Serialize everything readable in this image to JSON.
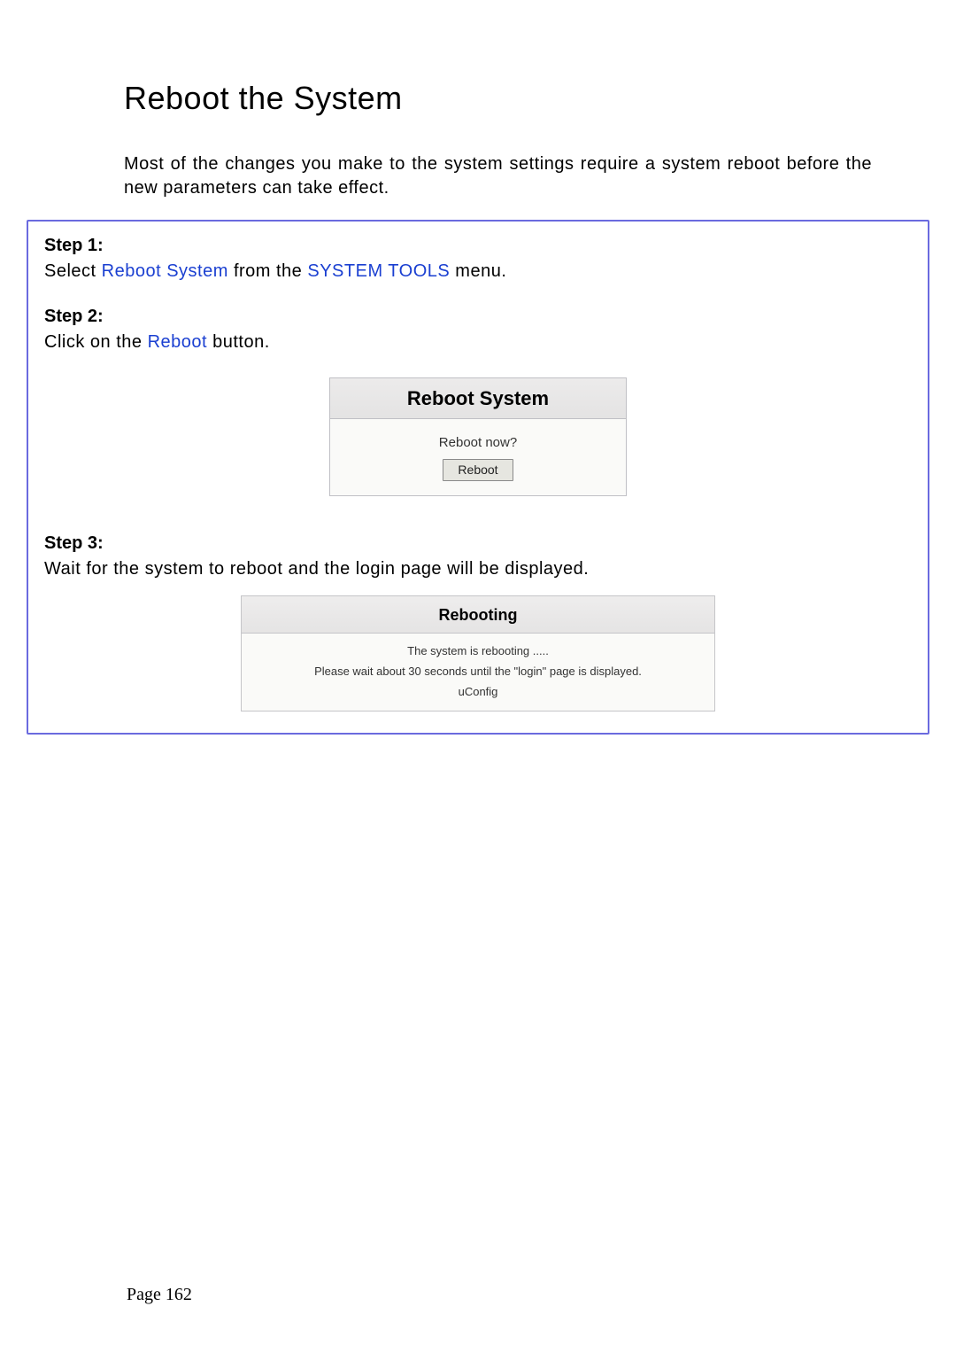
{
  "title": "Reboot the System",
  "intro": "Most of the changes you make to the system settings require a system reboot before the new parameters can take effect.",
  "step1": {
    "label": "Step 1:",
    "pre": "Select ",
    "link1": "Reboot System",
    "mid": " from the ",
    "link2": "SYSTEM TOOLS",
    "post": " menu."
  },
  "step2": {
    "label": "Step 2:",
    "pre": "Click on the ",
    "link": "Reboot",
    "post": " button."
  },
  "reboot_panel": {
    "header": "Reboot System",
    "question": "Reboot now?",
    "button": "Reboot"
  },
  "step3": {
    "label": "Step 3:",
    "text": "Wait for the system to reboot and the login page will be displayed."
  },
  "rebooting_panel": {
    "header": "Rebooting",
    "line1": "The system is rebooting .....",
    "line2": "Please wait about 30 seconds until the \"login\" page is displayed.",
    "line3": "uConfig"
  },
  "page_number": "Page 162"
}
